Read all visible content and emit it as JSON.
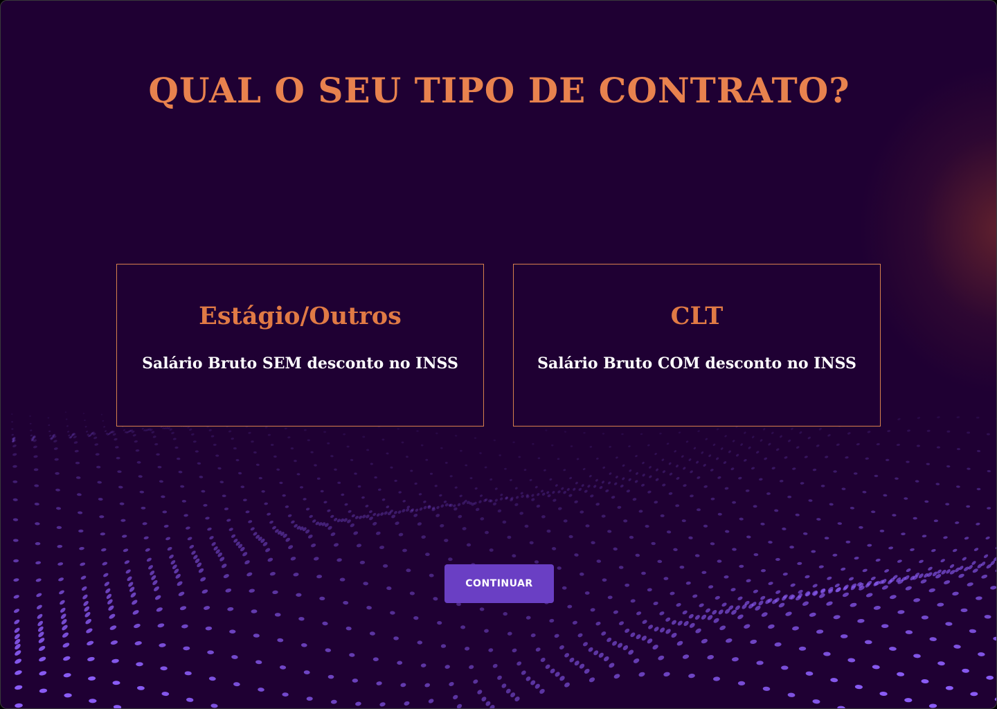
{
  "page": {
    "title": "QUAL O SEU TIPO DE CONTRATO?"
  },
  "options": [
    {
      "title": "Estágio/Outros",
      "description": "Salário Bruto SEM desconto no INSS"
    },
    {
      "title": "CLT",
      "description": "Salário Bruto COM desconto no INSS"
    }
  ],
  "actions": {
    "continue_label": "CONTINUAR"
  },
  "colors": {
    "background": "#1f0033",
    "accent": "#e8824e",
    "card_border": "#d9814d",
    "button": "#6a3fc4",
    "dots": "#8a5cf6"
  }
}
